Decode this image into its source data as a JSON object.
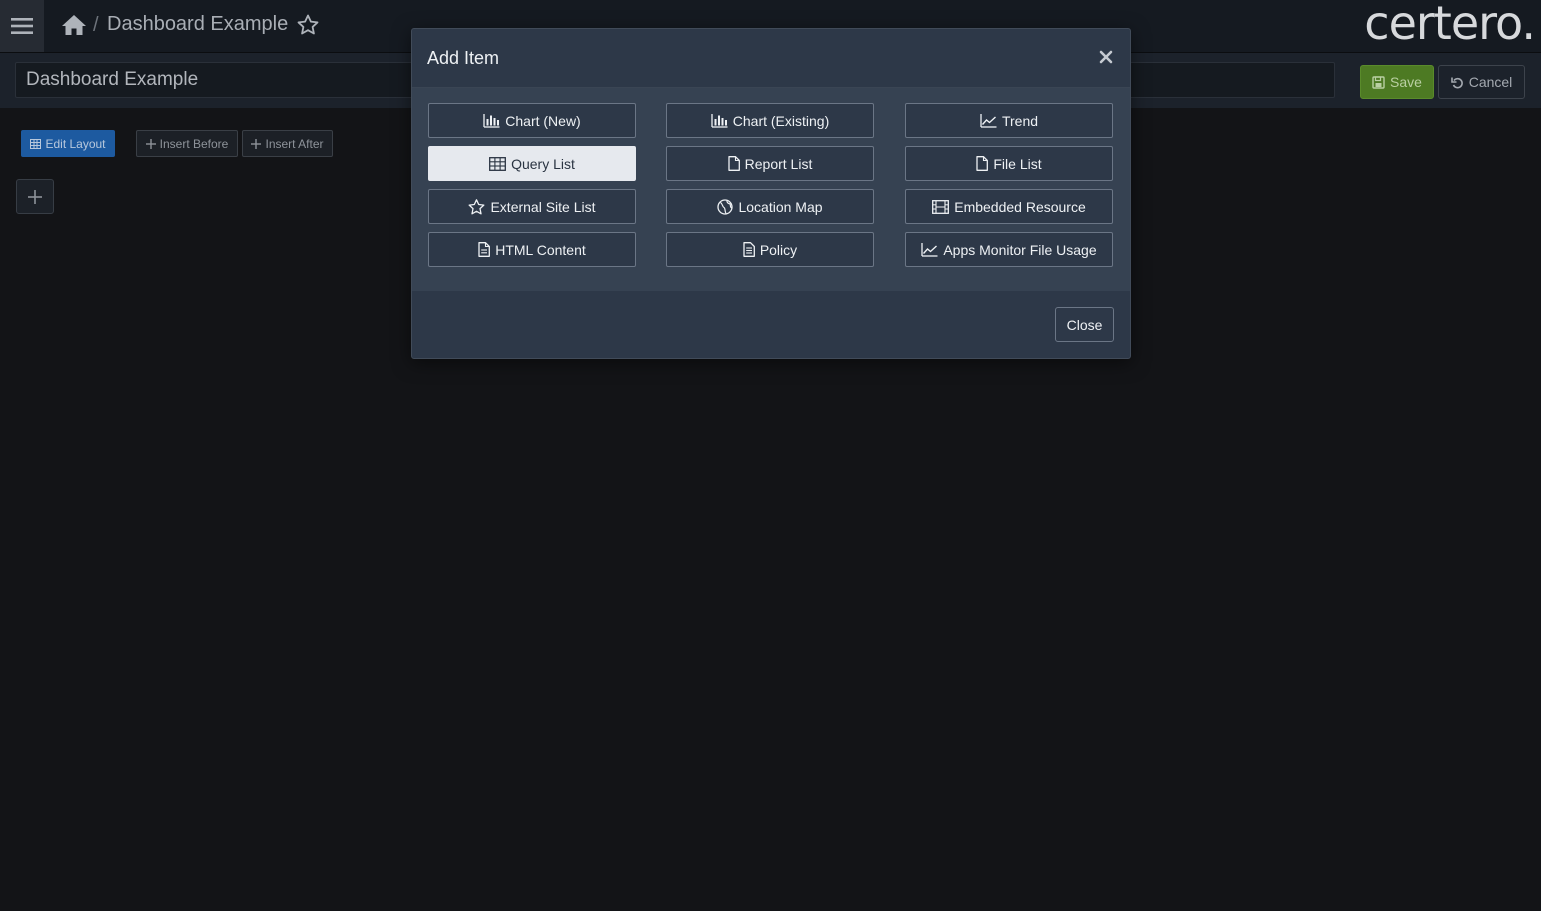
{
  "header": {
    "breadcrumb_separator": "/",
    "breadcrumb_title": "Dashboard Example",
    "logo_text": "certero."
  },
  "toolbar": {
    "title_value": "Dashboard Example",
    "save_label": "Save",
    "cancel_label": "Cancel",
    "edit_layout_label": "Edit Layout",
    "insert_before_label": "Insert Before",
    "insert_after_label": "Insert After",
    "add_cell_icon": "plus-icon"
  },
  "modal": {
    "title": "Add Item",
    "close_label": "Close",
    "items": [
      {
        "label": "Chart (New)",
        "icon": "bar-chart-icon",
        "active": false
      },
      {
        "label": "Chart (Existing)",
        "icon": "bar-chart-icon",
        "active": false
      },
      {
        "label": "Trend",
        "icon": "line-chart-icon",
        "active": false
      },
      {
        "label": "Query List",
        "icon": "table-icon",
        "active": true
      },
      {
        "label": "Report List",
        "icon": "file-icon",
        "active": false
      },
      {
        "label": "File List",
        "icon": "file-icon",
        "active": false
      },
      {
        "label": "External Site List",
        "icon": "star-icon",
        "active": false
      },
      {
        "label": "Location Map",
        "icon": "globe-icon",
        "active": false
      },
      {
        "label": "Embedded Resource",
        "icon": "film-icon",
        "active": false
      },
      {
        "label": "HTML Content",
        "icon": "file-text-icon",
        "active": false
      },
      {
        "label": "Policy",
        "icon": "file-lines-icon",
        "active": false
      },
      {
        "label": "Apps Monitor File Usage",
        "icon": "line-chart-icon",
        "active": false
      }
    ]
  },
  "colors": {
    "save_green": "#4d7a23",
    "edit_layout_blue": "#1d5aa0",
    "modal_bg": "#2d3848",
    "page_bg": "#131417"
  }
}
